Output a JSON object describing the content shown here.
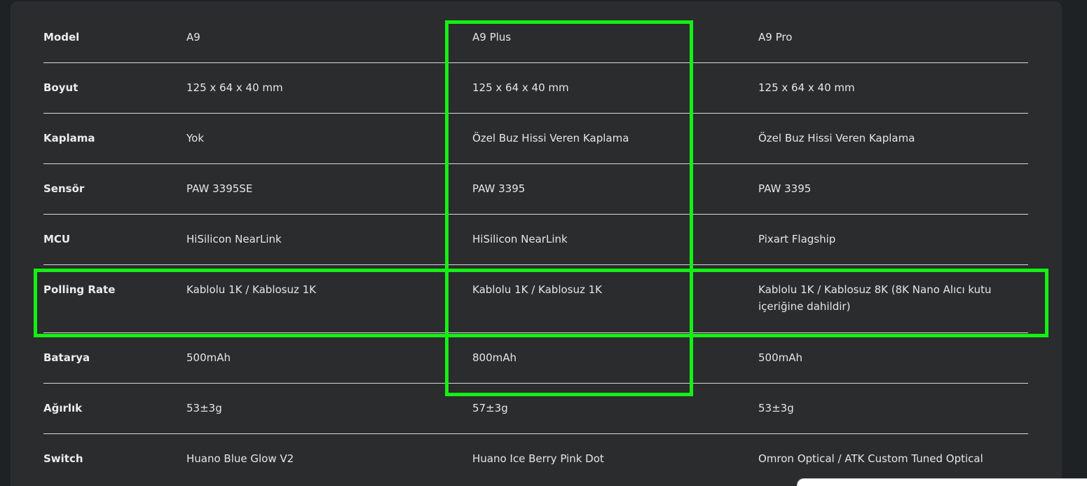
{
  "specs": {
    "rows": [
      {
        "label": "Model",
        "values": [
          "A9",
          "A9 Plus",
          "A9 Pro"
        ]
      },
      {
        "label": "Boyut",
        "values": [
          "125 x 64 x 40 mm",
          "125 x 64 x 40 mm",
          "125 x 64 x 40 mm"
        ]
      },
      {
        "label": "Kaplama",
        "values": [
          "Yok",
          "Özel Buz Hissi Veren Kaplama",
          "Özel Buz Hissi Veren Kaplama"
        ]
      },
      {
        "label": "Sensör",
        "values": [
          "PAW 3395SE",
          "PAW 3395",
          "PAW 3395"
        ]
      },
      {
        "label": "MCU",
        "values": [
          "HiSilicon NearLink",
          "HiSilicon NearLink",
          "Pixart Flagship"
        ]
      },
      {
        "label": "Polling Rate",
        "values": [
          "Kablolu 1K / Kablosuz 1K",
          "Kablolu 1K / Kablosuz 1K",
          "Kablolu 1K / Kablosuz 8K (8K Nano Alıcı kutu içeriğine dahildir)"
        ]
      },
      {
        "label": "Batarya",
        "values": [
          "500mAh",
          "800mAh",
          "500mAh"
        ]
      },
      {
        "label": "Ağırlık",
        "values": [
          "53±3g",
          "57±3g",
          "53±3g"
        ]
      },
      {
        "label": "Switch",
        "values": [
          "Huano Blue Glow V2",
          "Huano Ice Berry Pink Dot",
          "Omron Optical / ATK Custom Tuned Optical"
        ]
      }
    ]
  },
  "colors": {
    "highlight": "#14f014",
    "card_background": "#2b2c2e",
    "page_background": "#1f2224",
    "divider": "#d8d8d8",
    "text": "#e6e6e6"
  }
}
